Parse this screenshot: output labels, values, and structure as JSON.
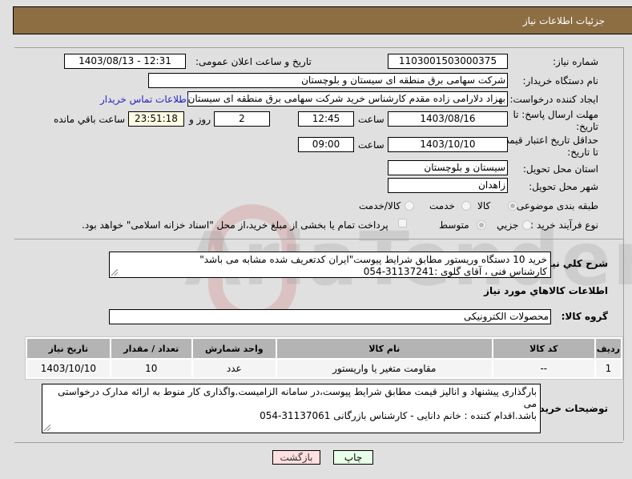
{
  "header": {
    "title": "جزئیات اطلاعات نیاز"
  },
  "form": {
    "need_number": {
      "label": "شماره نیاز:",
      "value": "1103001503000375"
    },
    "announce_datetime": {
      "label": "تاریخ و ساعت اعلان عمومی:",
      "value": "1403/08/13 - 12:31"
    },
    "buyer_org": {
      "label": "نام دستگاه خریدار:",
      "value": "شرکت سهامی برق منطقه ای سیستان و بلوچستان"
    },
    "requester": {
      "label": "ایجاد کننده درخواست:",
      "value": "بهزاد  دلارامی زاده مقدم کارشناس خرید شرکت سهامی برق منطقه ای سیستان و بلوچستان"
    },
    "buyer_contact_link": "اطلاعات تماس خریدار",
    "reply_deadline": {
      "label": "مهلت ارسال پاسخ: تا تاریخ:",
      "date": "1403/08/16",
      "time_label": "ساعت",
      "time": "12:45",
      "days": "2",
      "days_label": "روز و",
      "remaining": "23:51:18",
      "remaining_label": "ساعت باقي مانده"
    },
    "price_validity": {
      "label": "حداقل تاریخ اعتبار قیمت: تا تاریخ:",
      "date": "1403/10/10",
      "time_label": "ساعت",
      "time": "09:00"
    },
    "delivery_province": {
      "label": "استان محل تحویل:",
      "value": "سیستان و بلوچستان"
    },
    "delivery_city": {
      "label": "شهر محل تحویل:",
      "value": "زاهدان"
    },
    "category": {
      "label": "طبقه بندی موضوعی:",
      "options": [
        "کالا",
        "خدمت",
        "کالا/خدمت"
      ],
      "selected": "کالا"
    },
    "purchase_process": {
      "label": "نوع فرآیند خرید :",
      "options": [
        "جزیي",
        "متوسط"
      ],
      "selected": "متوسط",
      "treasury_checkbox_label": "پرداخت تمام یا بخشی از مبلغ خرید،از محل \"اسناد خزانه اسلامی\" خواهد بود.",
      "treasury_checked": false
    }
  },
  "description": {
    "label": "شرح کلي نياز:",
    "line1": "خرید 10 دستگاه وریستور مطابق شرایط پیوست\"ایران کدتعریف شده مشابه می باشد\"",
    "line2": "کارشناس فنی ، آقای گلوی :31137241-054"
  },
  "goods_section": {
    "title": "اطلاعات کالاهاي مورد نياز",
    "group_label": "گروه کالا:",
    "group_value": "محصولات الکترونیکی",
    "columns": [
      "ردیف",
      "کد کالا",
      "نام کالا",
      "واحد شمارش",
      "تعداد / مقدار",
      "تاریخ نیاز"
    ],
    "rows": [
      [
        "1",
        "--",
        "مقاومت متغیر یا واریستور",
        "عدد",
        "10",
        "1403/10/10"
      ]
    ]
  },
  "buyer_notes": {
    "label": "توضیحات خریدار:",
    "line1": "بارگذاری پیشنهاد و انالیز قیمت مطابق شرایط پیوست،در سامانه الزامیست.واگذاری کار منوط به ارائه مدارک درخواستی می",
    "line2": "باشد.اقدام کننده : خانم دانایی - کارشناس بازرگانی 31137061-054"
  },
  "buttons": {
    "print": "چاپ",
    "back": "بازگشت"
  },
  "watermark": "AriaTender.neT",
  "colors": {
    "header_bg": "#8d6e43",
    "print_bg": "#e8ffe8",
    "back_bg": "#ffe0e0",
    "link": "#2323c8"
  }
}
